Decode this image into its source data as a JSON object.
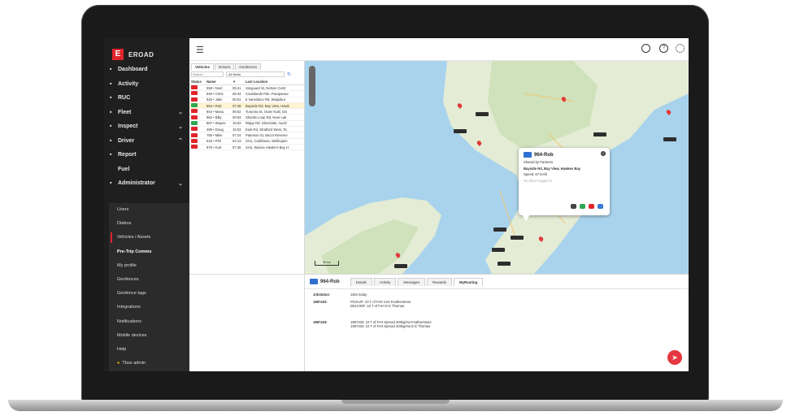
{
  "brand": {
    "logo_mark": "E",
    "name": "EROAD",
    "accent": "#e0242b"
  },
  "sidebar": {
    "items": [
      {
        "label": "Dashboard",
        "icon": "grid-icon",
        "chevron": ""
      },
      {
        "label": "Activity",
        "icon": "bar-chart-icon",
        "chevron": ""
      },
      {
        "label": "RUC",
        "icon": "bank-icon",
        "chevron": ""
      },
      {
        "label": "Fleet",
        "icon": "truck-icon",
        "chevron": "⌄"
      },
      {
        "label": "Inspect",
        "icon": "tools-icon",
        "chevron": "⌄"
      },
      {
        "label": "Driver",
        "icon": "person-icon",
        "chevron": "⌃"
      },
      {
        "label": "Report",
        "icon": "document-icon",
        "chevron": ""
      },
      {
        "label": "Fuel",
        "icon": "",
        "chevron": ""
      },
      {
        "label": "Administrator",
        "icon": "admin-icon",
        "chevron": "⌄"
      }
    ],
    "subitems": [
      {
        "label": "Users",
        "active": false,
        "bold": false
      },
      {
        "label": "Dtabos",
        "active": false,
        "bold": false
      },
      {
        "label": "Vehicles / Assets",
        "active": true,
        "bold": false
      },
      {
        "label": "Pre-Trip Comms",
        "active": false,
        "bold": true
      },
      {
        "label": "My profile",
        "active": false,
        "bold": false
      },
      {
        "label": "Geofences",
        "active": false,
        "bold": false
      },
      {
        "label": "Geofence tags",
        "active": false,
        "bold": false
      },
      {
        "label": "Integrations",
        "active": false,
        "bold": false
      },
      {
        "label": "Notifications",
        "active": false,
        "bold": false
      },
      {
        "label": "Mobile devices",
        "active": false,
        "bold": false
      },
      {
        "label": "Help",
        "active": false,
        "bold": false
      }
    ],
    "user": "Tbox admin"
  },
  "topbar": {
    "menu_icon": "hamburger-icon",
    "icons": [
      "globe-icon",
      "help-icon",
      "gear-icon"
    ]
  },
  "vehicles_panel": {
    "tabs": [
      "Vehicles",
      "Drivers",
      "Geofences"
    ],
    "search_placeholder": "Search",
    "fleet_select": "All fleets",
    "columns": [
      "Status",
      "Name",
      "▼",
      "Last Location"
    ],
    "rows": [
      {
        "status": "#e0242b",
        "name": "558 • Noel",
        "time": "05:41",
        "loc": "Vanguard St, Nelson Centr",
        "selected": false
      },
      {
        "status": "#e0242b",
        "name": "940 • Chris",
        "time": "06:33",
        "loc": "Coastlands Pde, Paraparaur",
        "selected": false
      },
      {
        "status": "#e0242b",
        "name": "925 • Jake",
        "time": "06:51",
        "loc": "6 Vaneslaco Rd, Waipukur",
        "selected": false
      },
      {
        "status": "#2fa84f",
        "name": "964 • Rob",
        "time": "07:48",
        "loc": "Bayside Rd, Bay View, Hawk",
        "selected": true
      },
      {
        "status": "#e0242b",
        "name": "944 • Manu",
        "time": "06:02",
        "loc": "Turanira St, Outer Kaiti, Gis",
        "selected": false
      },
      {
        "status": "#e0242b",
        "name": "962 • Billy",
        "time": "06:53",
        "loc": "Shanks Loop Rd, Near Lak",
        "selected": false
      },
      {
        "status": "#2fa84f",
        "name": "887 • Wayne",
        "time": "15:53",
        "loc": "Ridge Rd, Silverdale, Auckl",
        "selected": false
      },
      {
        "status": "#e0242b",
        "name": "489 • Doug",
        "time": "15:03",
        "loc": "East Rd, Stratford West, Ta",
        "selected": false
      },
      {
        "status": "#e0242b",
        "name": "785 • Mike",
        "time": "07:24",
        "loc": "Paterson St, Bacot Reserve",
        "selected": false
      },
      {
        "status": "#e0242b",
        "name": "516 • Phil",
        "time": "04:13",
        "loc": "SH1, Caribbean, Wellington",
        "selected": false
      },
      {
        "status": "#e0242b",
        "name": "976 • Kurt",
        "time": "07:48",
        "loc": "SH2, Wairoa Hawke's Bay H",
        "selected": false
      }
    ],
    "pager": {
      "prev": "«  ‹",
      "page_label": "Page",
      "of_label": "of 1",
      "next": "›  »",
      "count": "1-11 of 11"
    }
  },
  "popup": {
    "title": "964-Rob",
    "driver": "Shared by Partners",
    "location": "Bayside Rd, Bay View, Hawkes Bay",
    "speed": "Speed: 67 km/h",
    "status": "No driver logged in"
  },
  "map": {
    "scale": "50 km"
  },
  "details": {
    "vehicle": "964-Rob",
    "tabs": [
      "Details",
      "Activity",
      "Messages",
      "Rewards",
      "MyRouting"
    ],
    "active_tab": "MyRouting",
    "fields": [
      {
        "key": "Jobstatus:",
        "value": "Jobs today"
      },
      {
        "key": "1987433:",
        "value": "PICKUP: 10 T of Fert Cert Featherstone\nDELIVER: 10 T of Fert D E Thomas"
      },
      {
        "key": "1987433:",
        "value": "1987433: 10 T of Fert Spread 200kg/Ha Featherstone\n1987433: 10 T of Fert Spread 200kg/Ha D E Thomas"
      }
    ],
    "fab_icon": "compass-icon"
  }
}
